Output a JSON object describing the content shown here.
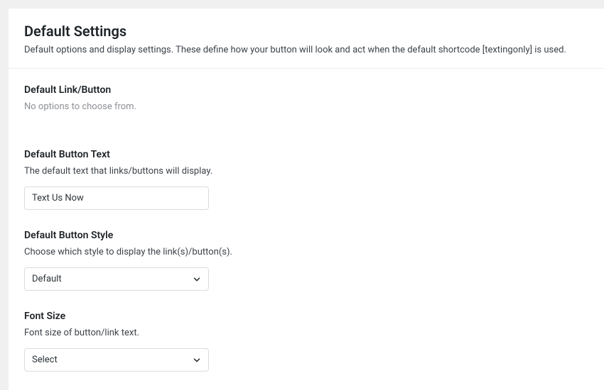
{
  "header": {
    "title": "Default Settings",
    "description": "Default options and display settings. These define how your button will look and act when the default shortcode [textingonly] is used."
  },
  "sections": {
    "link_button": {
      "title": "Default Link/Button",
      "empty_message": "No options to choose from."
    },
    "button_text": {
      "title": "Default Button Text",
      "description": "The default text that links/buttons will display.",
      "value": "Text Us Now"
    },
    "button_style": {
      "title": "Default Button Style",
      "description": "Choose which style to display the link(s)/button(s).",
      "value": "Default"
    },
    "font_size": {
      "title": "Font Size",
      "description": "Font size of button/link text.",
      "value": "Select"
    }
  }
}
